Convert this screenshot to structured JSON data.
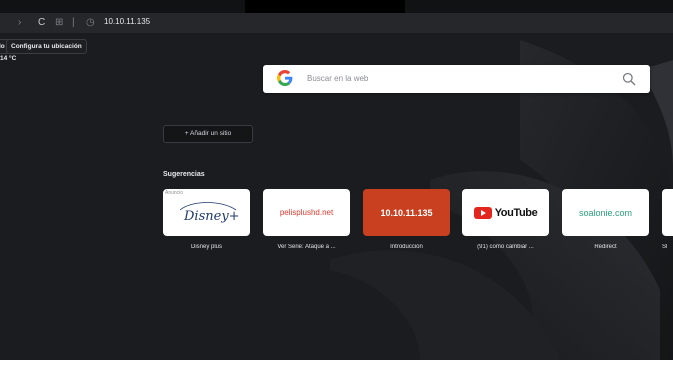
{
  "browser": {
    "url": "10.10.11.135",
    "nav_glyphs": {
      "forward": "›",
      "reload": "C",
      "grid": "⊞",
      "separator": "|",
      "info": "◷"
    }
  },
  "location": {
    "chip_partial": "lo",
    "configure_label": "Configura tu ubicación",
    "weather": "14 °C"
  },
  "search": {
    "placeholder": "Buscar en la web",
    "logo_letter": "G",
    "colors": {
      "blue": "#4285F4",
      "red": "#EA4335",
      "yellow": "#FBBC05",
      "green": "#34A853"
    }
  },
  "add_site": {
    "label": "+ Añadir un sitio"
  },
  "suggestions": {
    "title": "Sugerencias",
    "tiles": [
      {
        "logo_text": "Disney+",
        "caption": "Disney plus",
        "ad_label": "Anuncio",
        "bg": "#ffffff"
      },
      {
        "logo_text": "pelisplushd.net",
        "caption": "Ver Serie: Ataque a ...",
        "bg": "#ffffff"
      },
      {
        "logo_text": "10.10.11.135",
        "caption": "Introducción",
        "bg": "#c8401f"
      },
      {
        "logo_text": "YouTube",
        "caption": "(91) como cambiar ...",
        "bg": "#ffffff"
      },
      {
        "logo_text": "soalonie.com",
        "caption": "Redirect",
        "bg": "#ffffff"
      },
      {
        "logo_text": "",
        "caption": "Sl",
        "bg": "#ffffff"
      }
    ]
  }
}
